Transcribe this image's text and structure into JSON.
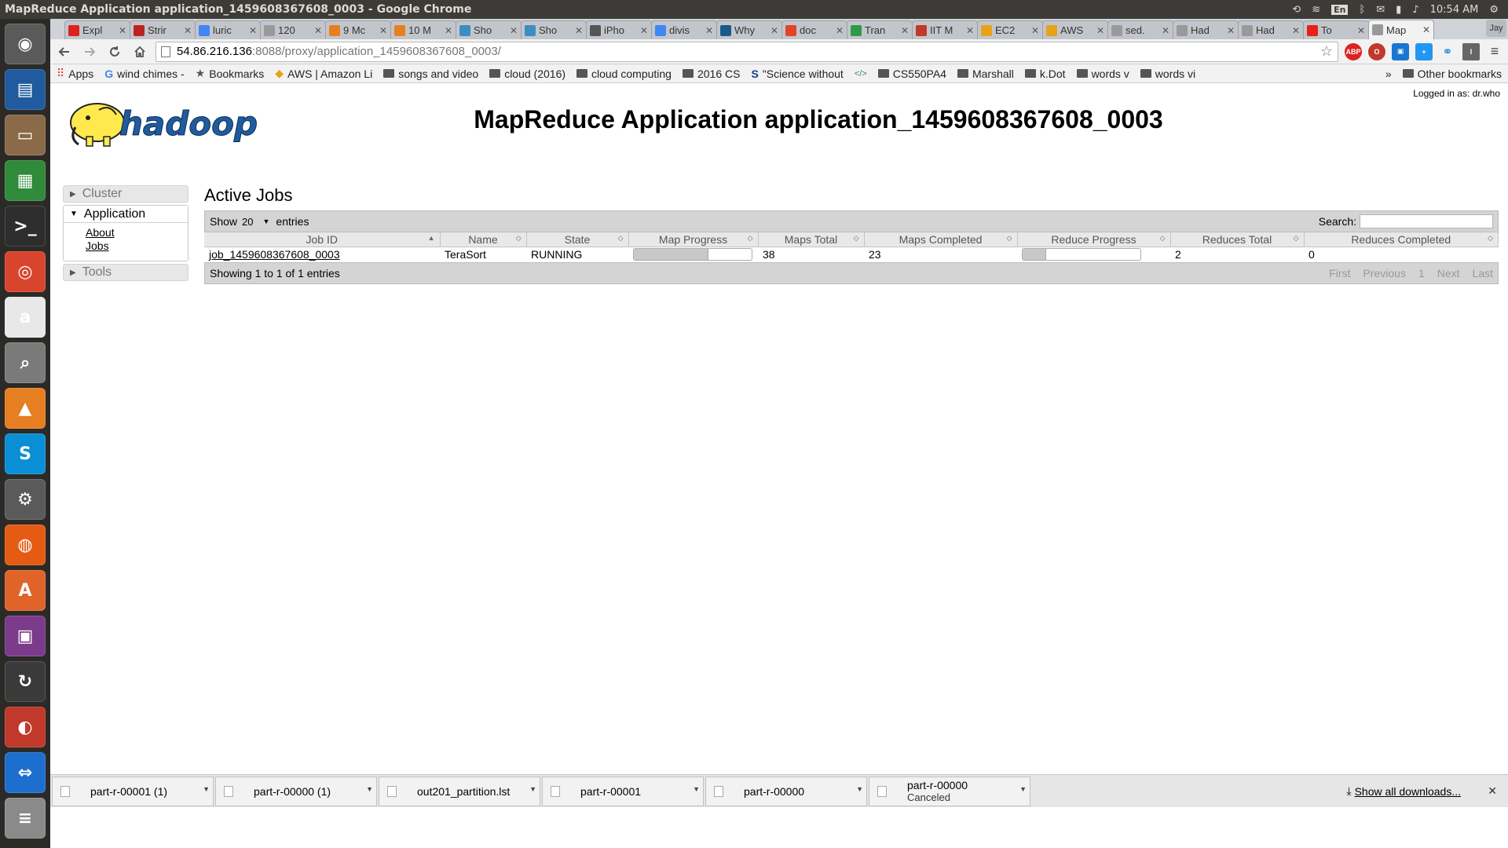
{
  "os": {
    "window_title": "MapReduce Application application_1459608367608_0003 - Google Chrome",
    "clock": "10:54 AM",
    "keyboard": "En"
  },
  "launcher": [
    {
      "name": "ubuntu-dash-icon",
      "glyph": "◉",
      "color": "#5a5a5a"
    },
    {
      "name": "writer-icon",
      "glyph": "▤",
      "color": "#1f5b9e"
    },
    {
      "name": "files-icon",
      "glyph": "▭",
      "color": "#8a6a48"
    },
    {
      "name": "calc-icon",
      "glyph": "▦",
      "color": "#2f8a3a"
    },
    {
      "name": "terminal-icon",
      "glyph": ">_",
      "color": "#2d2d2d"
    },
    {
      "name": "chrome-icon",
      "glyph": "◎",
      "color": "#d9442e"
    },
    {
      "name": "amazon-icon",
      "glyph": "a",
      "color": "#e8e8e8"
    },
    {
      "name": "image-viewer-icon",
      "glyph": "⌕",
      "color": "#7a7a7a"
    },
    {
      "name": "vlc-icon",
      "glyph": "▲",
      "color": "#e67e22"
    },
    {
      "name": "skype-icon",
      "glyph": "S",
      "color": "#0a8fd6"
    },
    {
      "name": "settings-icon",
      "glyph": "⚙",
      "color": "#5a5a5a"
    },
    {
      "name": "firefox-icon",
      "glyph": "◍",
      "color": "#e55b13"
    },
    {
      "name": "software-center-icon",
      "glyph": "A",
      "color": "#e0642a"
    },
    {
      "name": "workspaces-icon",
      "glyph": "▣",
      "color": "#7b3b8a"
    },
    {
      "name": "updater-icon",
      "glyph": "↻",
      "color": "#3a3a3a"
    },
    {
      "name": "drive-icon",
      "glyph": "◐",
      "color": "#c0392b"
    },
    {
      "name": "teamviewer-icon",
      "glyph": "⇔",
      "color": "#1d6fcf"
    },
    {
      "name": "trash-icon",
      "glyph": "≡",
      "color": "#8a8a8a"
    }
  ],
  "tabs": [
    {
      "label": "Expl",
      "fav": "#d22",
      "active": false
    },
    {
      "label": "Strir",
      "fav": "#b22",
      "active": false
    },
    {
      "label": "luric",
      "fav": "#4285f4",
      "active": false
    },
    {
      "label": "120",
      "fav": "#999",
      "active": false
    },
    {
      "label": "9 Mc",
      "fav": "#e67e22",
      "active": false
    },
    {
      "label": "10 M",
      "fav": "#e67e22",
      "active": false
    },
    {
      "label": "Sho",
      "fav": "#3b8ec2",
      "active": false
    },
    {
      "label": "Sho",
      "fav": "#3b8ec2",
      "active": false
    },
    {
      "label": "iPho",
      "fav": "#555",
      "active": false
    },
    {
      "label": "divis",
      "fav": "#4285f4",
      "active": false
    },
    {
      "label": "Why",
      "fav": "#1a5a8a",
      "active": false
    },
    {
      "label": "doc",
      "fav": "#e24329",
      "active": false
    },
    {
      "label": "Tran",
      "fav": "#2e9a48",
      "active": false
    },
    {
      "label": "IIT M",
      "fav": "#c0392b",
      "active": false
    },
    {
      "label": "EC2",
      "fav": "#e8a21a",
      "active": false
    },
    {
      "label": "AWS",
      "fav": "#e8a21a",
      "active": false
    },
    {
      "label": "sed.",
      "fav": "#999",
      "active": false
    },
    {
      "label": "Had",
      "fav": "#999",
      "active": false
    },
    {
      "label": "Had",
      "fav": "#999",
      "active": false
    },
    {
      "label": "To",
      "fav": "#e62117",
      "active": false
    },
    {
      "label": "Map",
      "fav": "#999",
      "active": true
    }
  ],
  "profile": "Jay",
  "address": {
    "host": "54.86.216.136",
    "path": ":8088/proxy/application_1459608367608_0003/"
  },
  "bookmarks": [
    {
      "label": "Apps",
      "kind": "apps"
    },
    {
      "label": "wind chimes -",
      "kind": "google"
    },
    {
      "label": "Bookmarks",
      "kind": "star"
    },
    {
      "label": "AWS | Amazon Li",
      "kind": "aws"
    },
    {
      "label": "songs and video",
      "kind": "folder"
    },
    {
      "label": "cloud (2016)",
      "kind": "folder"
    },
    {
      "label": "cloud computing",
      "kind": "folder"
    },
    {
      "label": "2016 CS",
      "kind": "folder"
    },
    {
      "label": "\"Science without",
      "kind": "s"
    },
    {
      "label": "",
      "kind": "code"
    },
    {
      "label": "CS550PA4",
      "kind": "folder"
    },
    {
      "label": "Marshall",
      "kind": "folder"
    },
    {
      "label": "k.Dot",
      "kind": "folder"
    },
    {
      "label": "words v",
      "kind": "folder"
    },
    {
      "label": "words vi",
      "kind": "folder"
    }
  ],
  "bookmarks_other": "Other bookmarks",
  "page": {
    "logged_in": "Logged in as: dr.who",
    "logo_text": "hadoop",
    "title": "MapReduce Application application_1459608367608_0003",
    "nav": {
      "cluster": "Cluster",
      "application": "Application",
      "about": "About",
      "jobs": "Jobs",
      "tools": "Tools"
    },
    "section_title": "Active Jobs",
    "show_label": "Show",
    "show_value": "20",
    "entries_label": "entries",
    "search_label": "Search:",
    "columns": [
      "Job ID",
      "Name",
      "State",
      "Map Progress",
      "Maps Total",
      "Maps Completed",
      "Reduce Progress",
      "Reduces Total",
      "Reduces Completed"
    ],
    "rows": [
      {
        "job_id": "job_1459608367608_0003",
        "name": "TeraSort",
        "state": "RUNNING",
        "map_progress": 0.63,
        "maps_total": "38",
        "maps_completed": "23",
        "reduce_progress": 0.2,
        "reduces_total": "2",
        "reduces_completed": "0"
      }
    ],
    "info": "Showing 1 to 1 of 1 entries",
    "pager": [
      "First",
      "Previous",
      "1",
      "Next",
      "Last"
    ]
  },
  "downloads": [
    {
      "name": "part-r-00001 (1)",
      "status": ""
    },
    {
      "name": "part-r-00000 (1)",
      "status": ""
    },
    {
      "name": "out201_partition.lst",
      "status": ""
    },
    {
      "name": "part-r-00001",
      "status": ""
    },
    {
      "name": "part-r-00000",
      "status": ""
    },
    {
      "name": "part-r-00000",
      "status": "Canceled"
    }
  ],
  "show_all_downloads": "Show all downloads..."
}
